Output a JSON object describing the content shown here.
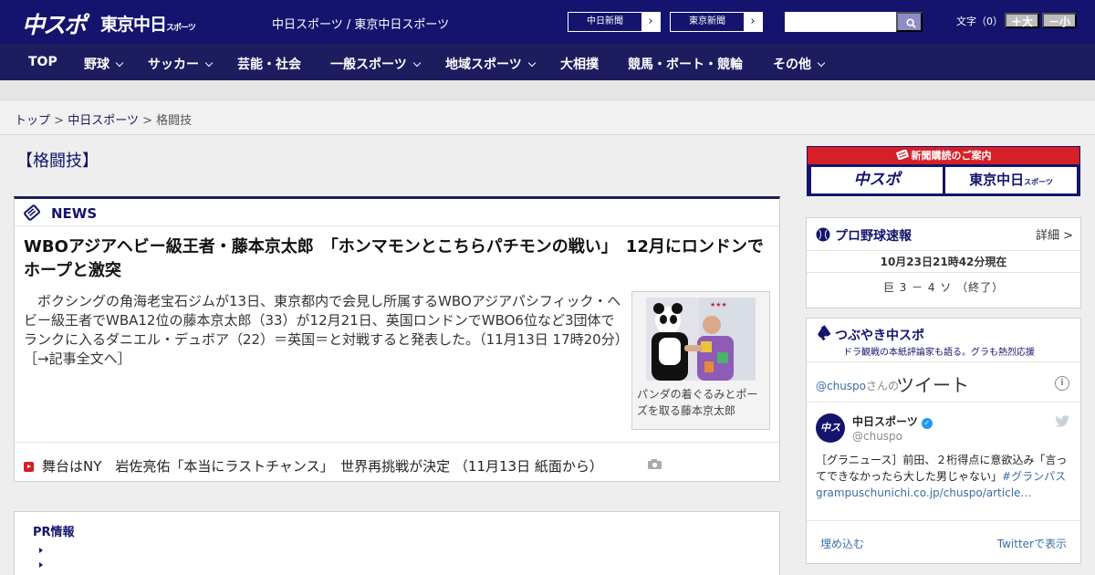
{
  "header": {
    "logo_chuspo": "中スポ",
    "logo_tokyo": "東京中日",
    "logo_tokyo_small": "スポーツ",
    "tagline": "中日スポーツ / 東京中日スポーツ",
    "link_chunichi": "中日新聞",
    "link_tokyo": "東京新聞",
    "search_placeholder": "",
    "fontsize_label": "文字（0）",
    "font_larger": "＋大",
    "font_smaller": "－小"
  },
  "nav": {
    "items": [
      "TOP",
      "野球",
      "サッカー",
      "芸能・社会",
      "一般スポーツ",
      "地域スポーツ",
      "大相撲",
      "競馬・ボート・競輪",
      "その他"
    ]
  },
  "breadcrumb": {
    "top": "トップ",
    "sep": ">",
    "site": "中日スポーツ",
    "current": "格闘技"
  },
  "category_title": "【格闘技】",
  "news": {
    "label": "NEWS",
    "headline": "WBOアジアヘビー級王者・藤本京太郎　「ホンマモンとこちらパチモンの戦い」　12月にロンドンでホープと激突",
    "body": "ボクシングの角海老宝石ジムが13日、東京都内で会見し所属するWBOアジアパシフィック・ヘビー級王者でWBA12位の藤本京太郎（33）が12月21日、英国ロンドンでWBO6位など3団体でランクに入るダニエル・デュボア（22）＝英国＝と対戦すると発表した。（11月13日 17時20分）",
    "more": "［→記事全文へ］",
    "photo_caption": "パンダの着ぐるみとポーズを取る藤本京太郎",
    "sub_item": "舞台はNY　岩佐亮佑「本当にラストチャンス」　世界再挑戦が決定 （11月13日 紙面から）"
  },
  "pr": {
    "label": "PR情報"
  },
  "sidebar": {
    "subscribe": {
      "title": "新聞購読のご案内",
      "left": "中スポ",
      "right": "東京中日",
      "right_small": "スポーツ"
    },
    "baseball": {
      "title": "プロ野球速報",
      "more": "詳細 >",
      "updated": "10月23日21時42分現在",
      "score": "巨 3 － 4 ソ （終了）"
    },
    "twitter": {
      "title": "つぶやき中スポ",
      "subtitle": "ドラ観戦の本紙評論家も語る。グラも熱烈応援",
      "handle": "@chuspo",
      "handle_suffix": "さんの",
      "tweets_label": "ツイート",
      "account_name": "中日スポーツ",
      "account_handle": "@chuspo",
      "avatar_text": "中スポ",
      "tweet_text": "［グラニュース］前田、２桁得点に意欲込み「言ってできなかったら大した男じゃない」",
      "tweet_tag": "#グランパス",
      "tweet_link": "grampuschunichi.co.jp/chuspo/article…",
      "embed": "埋め込む",
      "view_on": "Twitterで表示"
    }
  }
}
